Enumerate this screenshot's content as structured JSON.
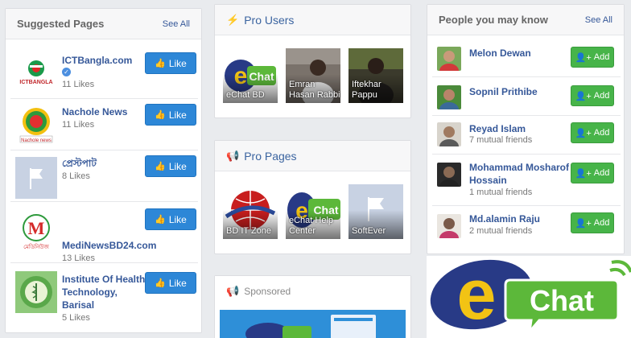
{
  "suggested": {
    "title": "Suggested Pages",
    "see_all": "See All",
    "like_label": "Like",
    "items": [
      {
        "name": "ICTBangla.com",
        "likes": "11 Likes",
        "verified": true
      },
      {
        "name": "Nachole News",
        "likes": "11 Likes"
      },
      {
        "name": "প্রেস্টপাট",
        "likes": "8 Likes"
      },
      {
        "name": "MediNewsBD24.com",
        "likes": "13 Likes"
      },
      {
        "name": "Institute Of Health Technology, Barisal",
        "likes": "5 Likes"
      }
    ],
    "thumb_texts": {
      "ictbangla": "ICTBANGLA",
      "nachole": "Nachole news",
      "medi": "মেডিনিউজ"
    }
  },
  "pro_users": {
    "title": "Pro Users",
    "tiles": [
      {
        "label": "eChat BD"
      },
      {
        "label": "Emran Hasan Rabbi"
      },
      {
        "label": "Iftekhar Pappu"
      }
    ]
  },
  "pro_pages": {
    "title": "Pro Pages",
    "tiles": [
      {
        "label": "BD IT Zone"
      },
      {
        "label": "eChat Help Center"
      },
      {
        "label": "SoftEver"
      }
    ]
  },
  "sponsored": {
    "title": "Sponsored"
  },
  "people": {
    "title": "People you may know",
    "see_all": "See All",
    "add_label": "Add",
    "items": [
      {
        "name": "Melon Dewan",
        "sub": ""
      },
      {
        "name": "Sopnil Prithibe",
        "sub": ""
      },
      {
        "name": "Reyad Islam",
        "sub": "7 mutual friends"
      },
      {
        "name": "Mohammad Mosharof Hossain",
        "sub": "1 mutual friends"
      },
      {
        "name": "Md.alamin Raju",
        "sub": "2 mutual friends"
      }
    ]
  },
  "logo": {
    "letter": "e",
    "word": "Chat"
  },
  "colors": {
    "link": "#365899",
    "like_button": "#2d87d7",
    "add_button": "#47b449",
    "logo_yellow": "#f2c314",
    "logo_green": "#5cb83a",
    "logo_navy": "#283a86"
  }
}
